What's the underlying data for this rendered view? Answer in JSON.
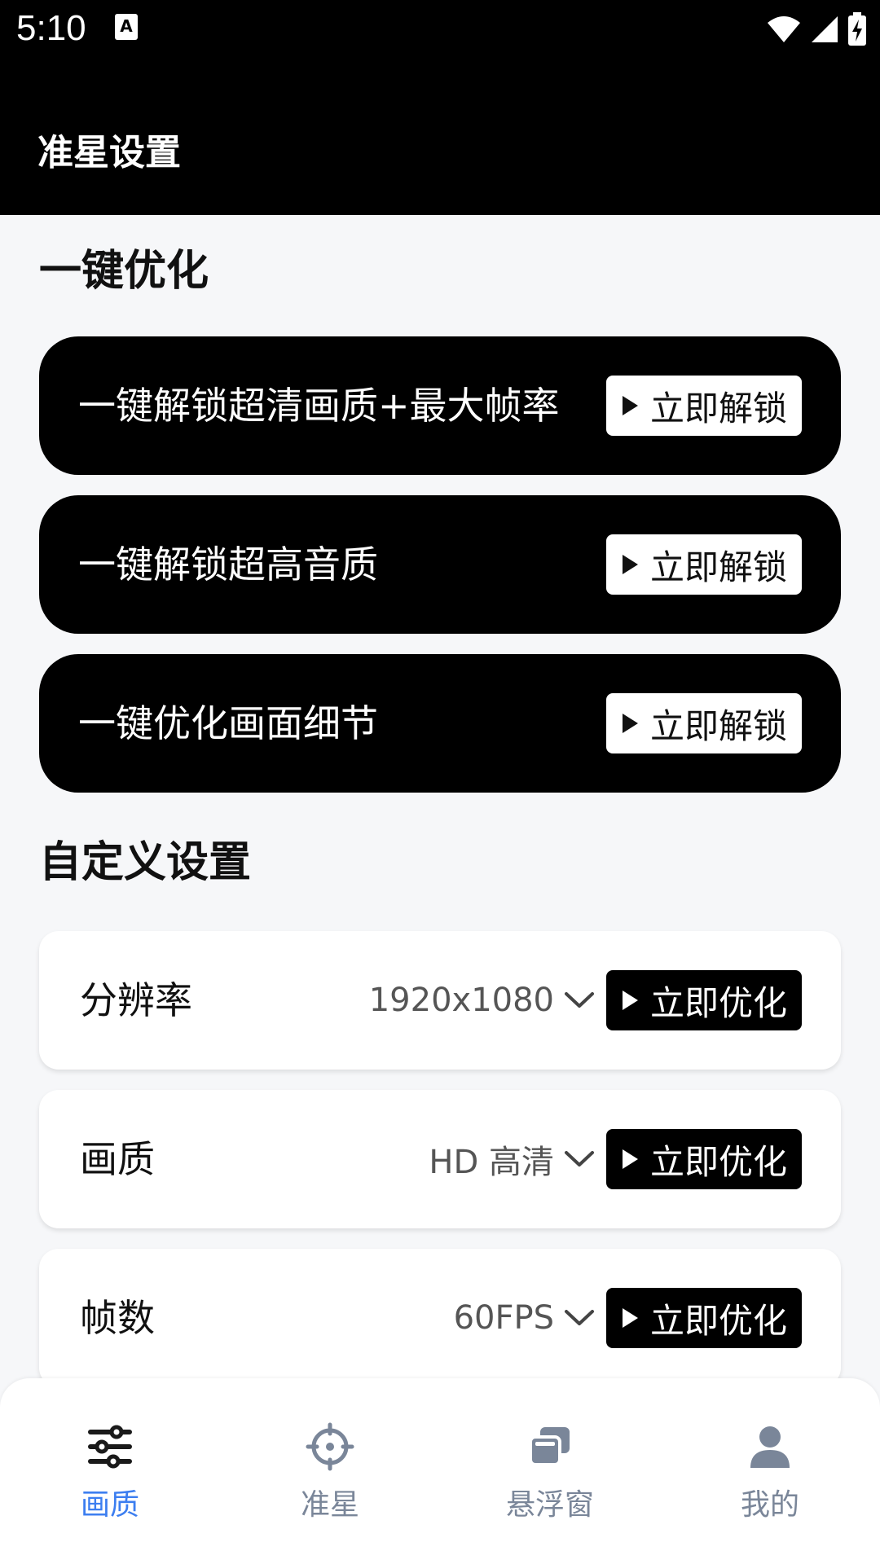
{
  "status_bar": {
    "time": "5:10"
  },
  "app_bar": {
    "title": "准星设置"
  },
  "sections": {
    "one_click_title": "一键优化",
    "custom_title": "自定义设置"
  },
  "unlock_items": [
    {
      "label": "一键解锁超清画质+最大帧率",
      "button": "立即解锁"
    },
    {
      "label": "一键解锁超高音质",
      "button": "立即解锁"
    },
    {
      "label": "一键优化画面细节",
      "button": "立即解锁"
    }
  ],
  "settings": [
    {
      "label": "分辨率",
      "value": "1920x1080",
      "button": "立即优化"
    },
    {
      "label": "画质",
      "value": "HD 高清",
      "button": "立即优化"
    },
    {
      "label": "帧数",
      "value": "60FPS",
      "button": "立即优化"
    }
  ],
  "bottom_nav": [
    {
      "label": "画质",
      "icon": "sliders-icon",
      "active": true
    },
    {
      "label": "准星",
      "icon": "crosshair-icon",
      "active": false
    },
    {
      "label": "悬浮窗",
      "icon": "floating-window-icon",
      "active": false
    },
    {
      "label": "我的",
      "icon": "person-icon",
      "active": false
    }
  ],
  "colors": {
    "active_tab": "#3c7ef0",
    "inactive_tab": "#7a8699",
    "header_bg": "#000000",
    "page_bg": "#f6f7f9"
  }
}
